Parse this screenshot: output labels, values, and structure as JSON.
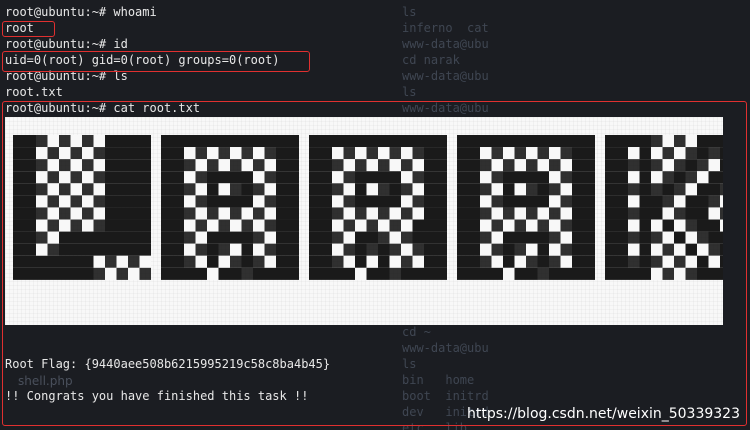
{
  "terminal": {
    "lines": [
      {
        "text": "root@ubuntu:~# whoami"
      },
      {
        "text": "root"
      },
      {
        "text": "root@ubuntu:~# id"
      },
      {
        "text": "uid=0(root) gid=0(root) groups=0(root)"
      },
      {
        "text": "root@ubuntu:~# ls"
      },
      {
        "text": "root.txt"
      },
      {
        "text": "root@ubuntu:~# cat root.txt"
      },
      {
        "text": "Root Flag: {9440aee508b6215995219c58c8ba4b45}"
      },
      {
        "text": "!! Congrats you have finished this task !!"
      }
    ]
  },
  "banner": {
    "word": "NARAK",
    "letters": [
      "###..##.......##",
      "###.#.##......##",
      "###.#.##......##",
      "###.#.##......##",
      "###.#.##......##",
      "###.#.##......##",
      "###.#.##......##",
      "###.#.##......##",
      "###.#.##......##",
      "###.#.##......##",
      "###.#.##......##"
    ]
  },
  "background": {
    "lines": [
      "ls",
      "inferno  cat",
      "www-data@ubu",
      "cd narak",
      "www-data@ubu",
      "ls",
      "www-data@ubu",
      "",
      "",
      "",
      "",
      "",
      "",
      "",
      "",
      "",
      "",
      "",
      "",
      "",
      "",
      "cd ~",
      "www-data@ubu",
      "ls",
      "bin   home",
      "boot  initrd",
      "dev   initrd",
      "etc   lib"
    ],
    "shell_label": "shell.php"
  },
  "watermark": "https://blog.csdn.net/weixin_50339323",
  "colors": {
    "highlight_box": "#e03030",
    "banner_bg": "#f8f8f8",
    "banner_fg": "#1a1a1a"
  }
}
